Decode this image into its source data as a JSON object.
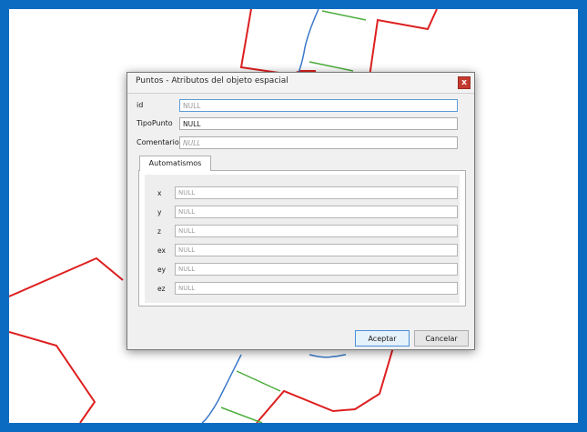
{
  "dialog": {
    "title": "Puntos - Atributos del objeto espacial",
    "close_label": "x",
    "fields": [
      {
        "label": "id",
        "placeholder": "NULL",
        "value": ""
      },
      {
        "label": "TipoPunto",
        "placeholder": "",
        "value": "NULL"
      },
      {
        "label": "Comentario",
        "placeholder": "NULL",
        "value": ""
      }
    ],
    "tab_label": "Automatismos",
    "auto_fields": [
      {
        "label": "x",
        "placeholder": "NULL"
      },
      {
        "label": "y",
        "placeholder": "NULL"
      },
      {
        "label": "z",
        "placeholder": "NULL"
      },
      {
        "label": "ex",
        "placeholder": "NULL"
      },
      {
        "label": "ey",
        "placeholder": "NULL"
      },
      {
        "label": "ez",
        "placeholder": "NULL"
      }
    ],
    "ok_label": "Aceptar",
    "cancel_label": "Cancelar"
  },
  "colors": {
    "frame": "#0a6bc0",
    "line_red": "#dd1f1f",
    "line_green": "#4aac3a",
    "line_blue": "#3a78c8"
  }
}
